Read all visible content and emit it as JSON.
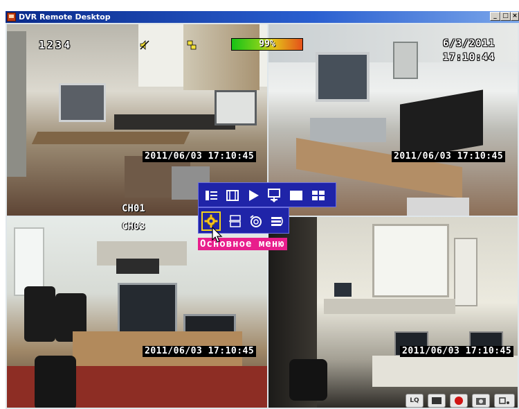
{
  "window": {
    "title": "DVR Remote Desktop",
    "controls": {
      "minimize": "_",
      "maximize": "□",
      "close": "×"
    }
  },
  "osd": {
    "camera_digits": "1234",
    "hdd_usage": "99%",
    "date": "6/3/2011",
    "time": "17:10:44",
    "icons": [
      "speaker-muted-icon",
      "network-icon"
    ]
  },
  "channels": [
    {
      "label": "CH01",
      "timestamp": "2011/06/03 17:10:45"
    },
    {
      "label": "",
      "timestamp": "2011/06/03 17:10:45"
    },
    {
      "label": "CH03",
      "timestamp": "2011/06/03 17:10:45"
    },
    {
      "label": "",
      "timestamp": "2011/06/03 17:10:45"
    }
  ],
  "quick_menu": {
    "row1": [
      "menu-list-icon",
      "filmstrip-icon",
      "play-icon",
      "display-icon",
      "single-view-icon",
      "quad-view-icon"
    ],
    "row2": [
      "main-menu-gear-icon",
      "record-list-icon",
      "dial-icon",
      "backup-icon"
    ],
    "tooltip": "Основное меню",
    "accent": "#e81e8c",
    "menu_color": "#1f24a8"
  },
  "bottom_toolbar": {
    "lq_label": "LQ",
    "buttons": [
      "lq-button",
      "monitor-button",
      "record-button",
      "snapshot-button",
      "more-button"
    ]
  }
}
